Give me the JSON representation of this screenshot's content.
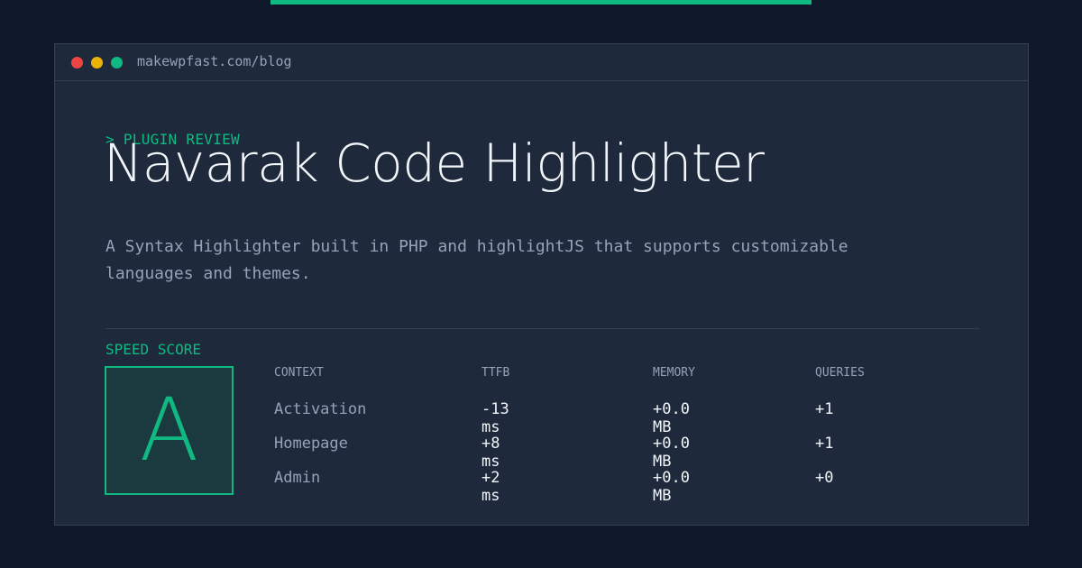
{
  "window": {
    "url": "makewpfast.com/blog"
  },
  "article": {
    "kicker": "> PLUGIN REVIEW",
    "title": "Navarak Code Highlighter",
    "description": "A Syntax Highlighter built in PHP and highlightJS that supports customizable languages and themes."
  },
  "speed": {
    "label": "SPEED SCORE",
    "grade": "A",
    "columns": [
      "CONTEXT",
      "TTFB",
      "MEMORY",
      "QUERIES"
    ],
    "rows": [
      {
        "context": "Activation",
        "ttfb": "-13 ms",
        "memory": "+0.0 MB",
        "queries": "+1"
      },
      {
        "context": "Homepage",
        "ttfb": "+8 ms",
        "memory": "+0.0 MB",
        "queries": "+1"
      },
      {
        "context": "Admin",
        "ttfb": "+2 ms",
        "memory": "+0.0 MB",
        "queries": "+0"
      }
    ]
  },
  "colors": {
    "accent": "#10b981",
    "background": "#0f172a",
    "panel": "#1e293b",
    "close": "#ef4444",
    "minimize": "#eab308",
    "maximize": "#10b981"
  }
}
